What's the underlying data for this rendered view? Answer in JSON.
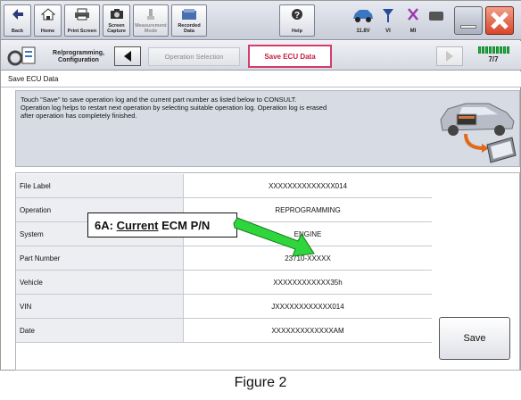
{
  "toolbar": {
    "buttons": [
      {
        "label": "Back"
      },
      {
        "label": "Home"
      },
      {
        "label": "Print Screen"
      },
      {
        "label": "Screen\nCapture"
      },
      {
        "label": "Measurement\nMode"
      },
      {
        "label": "Recorded\nData"
      },
      {
        "label": "Help"
      }
    ],
    "status": [
      {
        "label": "11.8V",
        "icon": "car-battery-icon"
      },
      {
        "label": "VI",
        "icon": "vi-signal-icon"
      },
      {
        "label": "MI",
        "icon": "mi-x-icon"
      }
    ]
  },
  "nav": {
    "reprog_label": "Re/programming,\nConfiguration",
    "step1": "Operation Selection",
    "step2": "Save ECU Data",
    "progress": "7/7"
  },
  "title": "Save ECU Data",
  "info_text": "Touch \"Save\" to save operation log and the current part number as listed below to CONSULT.\nOperation log helps to restart next operation by selecting suitable operation log. Operation log is erased\nafter operation has completely finished.",
  "table": {
    "rows": [
      {
        "label": "File Label",
        "value": "XXXXXXXXXXXXXX014"
      },
      {
        "label": "Operation",
        "value": "REPROGRAMMING"
      },
      {
        "label": "System",
        "value": "ENGINE"
      },
      {
        "label": "Part Number",
        "value": "23710-XXXXX"
      },
      {
        "label": "Vehicle",
        "value": "XXXXXXXXXXXX35h"
      },
      {
        "label": "VIN",
        "value": "JXXXXXXXXXXXX014"
      },
      {
        "label": "Date",
        "value": "XXXXXXXXXXXXXAM"
      }
    ]
  },
  "save_label": "Save",
  "callout": {
    "prefix": "6A: ",
    "word": "Current",
    "suffix": " ECM P/N"
  },
  "caption": "Figure 2",
  "colors": {
    "accent": "#d33c6b",
    "arrow": "#2fd63b",
    "progress": "#1fb040"
  }
}
